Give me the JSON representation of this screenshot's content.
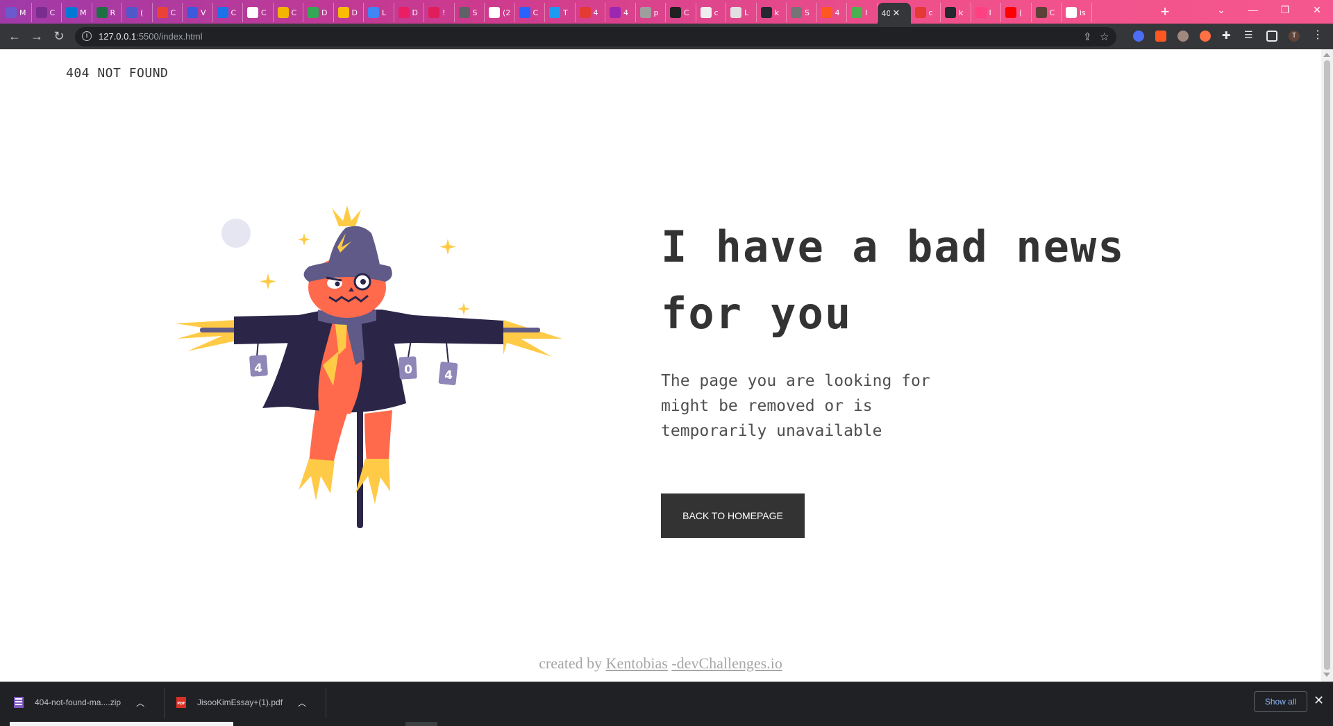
{
  "browser": {
    "tabs": [
      {
        "label": "M",
        "color": "#6a5acd"
      },
      {
        "label": "C",
        "color": "#7b2d8e"
      },
      {
        "label": "M",
        "color": "#0078d4"
      },
      {
        "label": "R",
        "color": "#1d7044"
      },
      {
        "label": "(",
        "color": "#5059c9"
      },
      {
        "label": "C",
        "color": "#ea4335"
      },
      {
        "label": "V",
        "color": "#3b5bdb"
      },
      {
        "label": "C",
        "color": "#1a73e8"
      },
      {
        "label": "C",
        "color": "#ffffff"
      },
      {
        "label": "C",
        "color": "#f4b400"
      },
      {
        "label": "D",
        "color": "#34a853"
      },
      {
        "label": "D",
        "color": "#fbbc05"
      },
      {
        "label": "L",
        "color": "#4285f4"
      },
      {
        "label": "D",
        "color": "#e91e63"
      },
      {
        "label": "!",
        "color": "#e01e5a"
      },
      {
        "label": "S",
        "color": "#5f6368"
      },
      {
        "label": "(2",
        "color": "#ffffff"
      },
      {
        "label": "C",
        "color": "#2962ff"
      },
      {
        "label": "T",
        "color": "#1d9bf0"
      },
      {
        "label": "4",
        "color": "#e53935"
      },
      {
        "label": "4",
        "color": "#9c27b0"
      },
      {
        "label": "p",
        "color": "#9e9e9e"
      },
      {
        "label": "C",
        "color": "#212121"
      },
      {
        "label": "c",
        "color": "#eeeeee"
      },
      {
        "label": "L",
        "color": "#e0e0e0"
      },
      {
        "label": "k",
        "color": "#24292f"
      },
      {
        "label": "S",
        "color": "#757575"
      },
      {
        "label": "4",
        "color": "#ff5722"
      },
      {
        "label": "I",
        "color": "#4caf50"
      }
    ],
    "active_tab": {
      "label": "40",
      "close": "✕"
    },
    "tabs_after": [
      {
        "label": "c",
        "color": "#e53935"
      },
      {
        "label": "k",
        "color": "#24292f"
      },
      {
        "label": "I",
        "color": "#ff4081"
      },
      {
        "label": "(",
        "color": "#ff0000"
      },
      {
        "label": "C",
        "color": "#5d4037"
      },
      {
        "label": "is",
        "color": "#ffffff"
      }
    ],
    "new_tab": "+",
    "url_host": "127.0.0.1",
    "url_path": ":5500/index.html",
    "profile_initial": "T"
  },
  "page": {
    "brand": "404 NOT FOUND",
    "headline": "I have a bad news for you",
    "description": "The page you are looking for might be removed or is temporarily unavailable",
    "button_label": "BACK TO HOMEPAGE",
    "footer": {
      "prefix": "created by ",
      "author": "Kentobias",
      "site": "-devChallenges.io"
    },
    "sign_labels": [
      "4",
      "0",
      "4"
    ]
  },
  "colors": {
    "text_dark": "#333333",
    "button_bg": "#333333",
    "scarecrow_coat": "#2b2547",
    "scarecrow_hat": "#5f5a87",
    "scarecrow_face": "#ff6a4d",
    "straw": "#ffcb47",
    "moon": "#e6e6f2"
  },
  "downloads": {
    "items": [
      {
        "name": "404-not-found-ma....zip",
        "type": "zip"
      },
      {
        "name": "JisooKimEssay+(1).pdf",
        "type": "pdf"
      }
    ],
    "show_all": "Show all",
    "close": "✕"
  }
}
